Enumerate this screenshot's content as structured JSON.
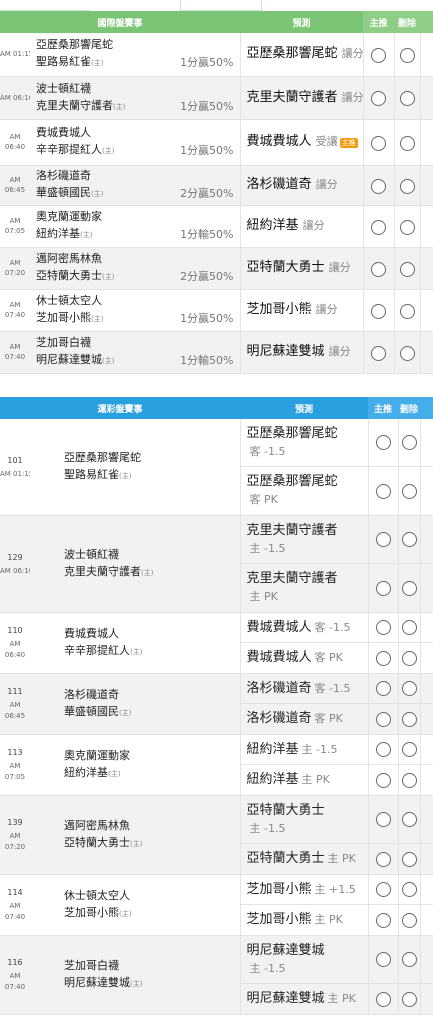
{
  "section1": {
    "headers": {
      "matches": "國際盤賽事",
      "prediction": "預測",
      "main": "主推",
      "delete": "刪除"
    },
    "rows": [
      {
        "time": "AM 01:15",
        "away": "亞歷桑那響尾蛇",
        "home": "聖路易紅雀",
        "home_mark": "(主)",
        "odds": "1分贏50%",
        "pick": "亞歷桑那響尾蛇",
        "pick_sub": "讓分",
        "badge": ""
      },
      {
        "time": "AM 06:10",
        "away": "波士頓紅襪",
        "home": "克里夫蘭守護者",
        "home_mark": "(主)",
        "odds": "1分贏50%",
        "pick": "克里夫蘭守護者",
        "pick_sub": "讓分",
        "badge": ""
      },
      {
        "time_a": "AM",
        "time_b": "06:40",
        "away": "費城費城人",
        "home": "辛辛那提紅人",
        "home_mark": "(主)",
        "odds": "1分贏50%",
        "pick": "費城費城人",
        "pick_sub": "受讓",
        "badge": "主推"
      },
      {
        "time_a": "AM",
        "time_b": "06:45",
        "away": "洛杉磯道奇",
        "home": "華盛頓國民",
        "home_mark": "(主)",
        "odds": "2分贏50%",
        "pick": "洛杉磯道奇",
        "pick_sub": "讓分",
        "badge": ""
      },
      {
        "time_a": "AM",
        "time_b": "07:05",
        "away": "奧克蘭運動家",
        "home": "紐約洋基",
        "home_mark": "(主)",
        "odds": "1分輸50%",
        "pick": "紐約洋基",
        "pick_sub": "讓分",
        "badge": ""
      },
      {
        "time_a": "AM",
        "time_b": "07:20",
        "away": "邁阿密馬林魚",
        "home": "亞特蘭大勇士",
        "home_mark": "(主)",
        "odds": "2分贏50%",
        "pick": "亞特蘭大勇士",
        "pick_sub": "讓分",
        "badge": ""
      },
      {
        "time_a": "AM",
        "time_b": "07:40",
        "away": "休士頓太空人",
        "home": "芝加哥小熊",
        "home_mark": "(主)",
        "odds": "1分贏50%",
        "pick": "芝加哥小熊",
        "pick_sub": "讓分",
        "badge": ""
      },
      {
        "time_a": "AM",
        "time_b": "07:40",
        "away": "芝加哥白襪",
        "home": "明尼蘇達雙城",
        "home_mark": "(主)",
        "odds": "1分輸50%",
        "pick": "明尼蘇達雙城",
        "pick_sub": "讓分",
        "badge": ""
      }
    ]
  },
  "section2": {
    "headers": {
      "matches": "運彩盤賽事",
      "prediction": "預測",
      "main": "主推",
      "delete": "刪除"
    },
    "rows": [
      {
        "num": "101",
        "time_a": "AM 01:15",
        "time_b": "",
        "away": "亞歷桑那響尾蛇",
        "home": "聖路易紅雀",
        "home_mark": "(主)",
        "picks": [
          {
            "team": "亞歷桑那響尾蛇",
            "sub": "客 -1.5",
            "style": "tall"
          },
          {
            "team": "亞歷桑那響尾蛇",
            "sub": "客 PK",
            "style": "tall"
          }
        ]
      },
      {
        "num": "129",
        "time_a": "AM 06:10",
        "time_b": "",
        "away": "波士頓紅襪",
        "home": "克里夫蘭守護者",
        "home_mark": "(主)",
        "picks": [
          {
            "team": "克里夫蘭守護者",
            "sub": "主 -1.5",
            "style": "tall"
          },
          {
            "team": "克里夫蘭守護者",
            "sub": "主 PK",
            "style": "tall"
          }
        ]
      },
      {
        "num": "110",
        "time_a": "AM",
        "time_b": "06:40",
        "away": "費城費城人",
        "home": "辛辛那提紅人",
        "home_mark": "(主)",
        "picks": [
          {
            "team": "費城費城人",
            "sub": "客 -1.5",
            "style": "short"
          },
          {
            "team": "費城費城人",
            "sub": "客 PK",
            "style": "short"
          }
        ]
      },
      {
        "num": "111",
        "time_a": "AM",
        "time_b": "06:45",
        "away": "洛杉磯道奇",
        "home": "華盛頓國民",
        "home_mark": "(主)",
        "picks": [
          {
            "team": "洛杉磯道奇",
            "sub": "客 -1.5",
            "style": "short"
          },
          {
            "team": "洛杉磯道奇",
            "sub": "客 PK",
            "style": "short"
          }
        ]
      },
      {
        "num": "113",
        "time_a": "AM",
        "time_b": "07:05",
        "away": "奧克蘭運動家",
        "home": "紐約洋基",
        "home_mark": "(主)",
        "picks": [
          {
            "team": "紐約洋基",
            "sub": "主 -1.5",
            "style": "short"
          },
          {
            "team": "紐約洋基",
            "sub": "主 PK",
            "style": "short"
          }
        ]
      },
      {
        "num": "139",
        "time_a": "AM",
        "time_b": "07:20",
        "away": "邁阿密馬林魚",
        "home": "亞特蘭大勇士",
        "home_mark": "(主)",
        "picks": [
          {
            "team": "亞特蘭大勇士",
            "sub": "主 -1.5",
            "style": "tall"
          },
          {
            "team": "亞特蘭大勇士",
            "sub": "主 PK",
            "style": "short"
          }
        ]
      },
      {
        "num": "114",
        "time_a": "AM",
        "time_b": "07:40",
        "away": "休士頓太空人",
        "home": "芝加哥小熊",
        "home_mark": "(主)",
        "picks": [
          {
            "team": "芝加哥小熊",
            "sub": "主 +1.5",
            "style": "short"
          },
          {
            "team": "芝加哥小熊",
            "sub": "主 PK",
            "style": "short"
          }
        ]
      },
      {
        "num": "116",
        "time_a": "AM",
        "time_b": "07:40",
        "away": "芝加哥白襪",
        "home": "明尼蘇達雙城",
        "home_mark": "(主)",
        "picks": [
          {
            "team": "明尼蘇達雙城",
            "sub": "主 -1.5",
            "style": "tall"
          },
          {
            "team": "明尼蘇達雙城",
            "sub": "主 PK",
            "style": "short"
          }
        ]
      }
    ]
  }
}
